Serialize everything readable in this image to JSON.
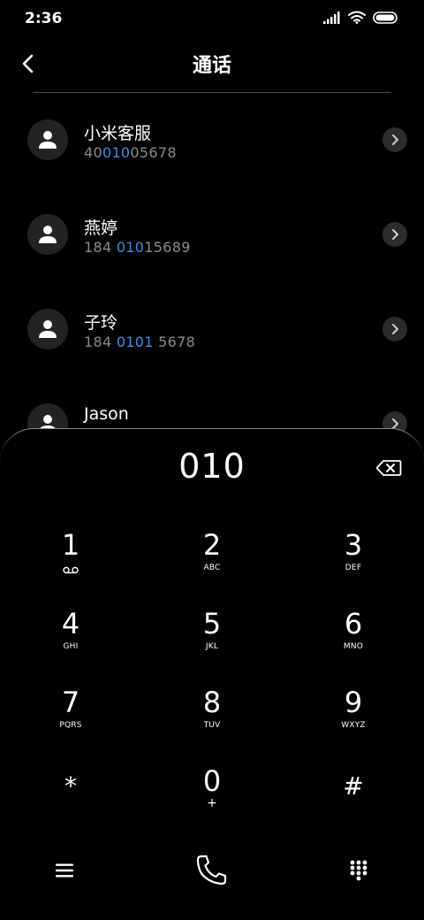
{
  "status_bar": {
    "time": "2:36"
  },
  "header": {
    "title": "通话"
  },
  "contacts": [
    {
      "name": "小米客服",
      "number_parts": [
        "40",
        "010",
        "05678"
      ]
    },
    {
      "name": "燕婷",
      "number_parts": [
        "184 ",
        "010",
        "15689"
      ]
    },
    {
      "name": "子玲",
      "number_parts": [
        "184 ",
        "0101",
        " 5678"
      ]
    },
    {
      "name": "Jason",
      "number_parts": [
        "",
        "",
        ""
      ]
    }
  ],
  "dialer": {
    "input": "010",
    "keys": [
      {
        "digit": "1",
        "letters": ""
      },
      {
        "digit": "2",
        "letters": "ABC"
      },
      {
        "digit": "3",
        "letters": "DEF"
      },
      {
        "digit": "4",
        "letters": "GHI"
      },
      {
        "digit": "5",
        "letters": "JKL"
      },
      {
        "digit": "6",
        "letters": "MNO"
      },
      {
        "digit": "7",
        "letters": "PQRS"
      },
      {
        "digit": "8",
        "letters": "TUV"
      },
      {
        "digit": "9",
        "letters": "WXYZ"
      },
      {
        "digit": "*",
        "letters": ""
      },
      {
        "digit": "0",
        "letters": "+"
      },
      {
        "digit": "#",
        "letters": ""
      }
    ]
  },
  "colors": {
    "highlight": "#3a8fe0",
    "background": "#000000",
    "avatar_bg": "#232323"
  },
  "icons": {
    "back": "chevron-left-icon",
    "chevron": "chevron-right-icon",
    "avatar": "person-icon",
    "backspace": "backspace-icon",
    "voicemail": "voicemail-icon",
    "menu": "menu-icon",
    "call": "phone-icon",
    "keypad": "keypad-icon"
  }
}
